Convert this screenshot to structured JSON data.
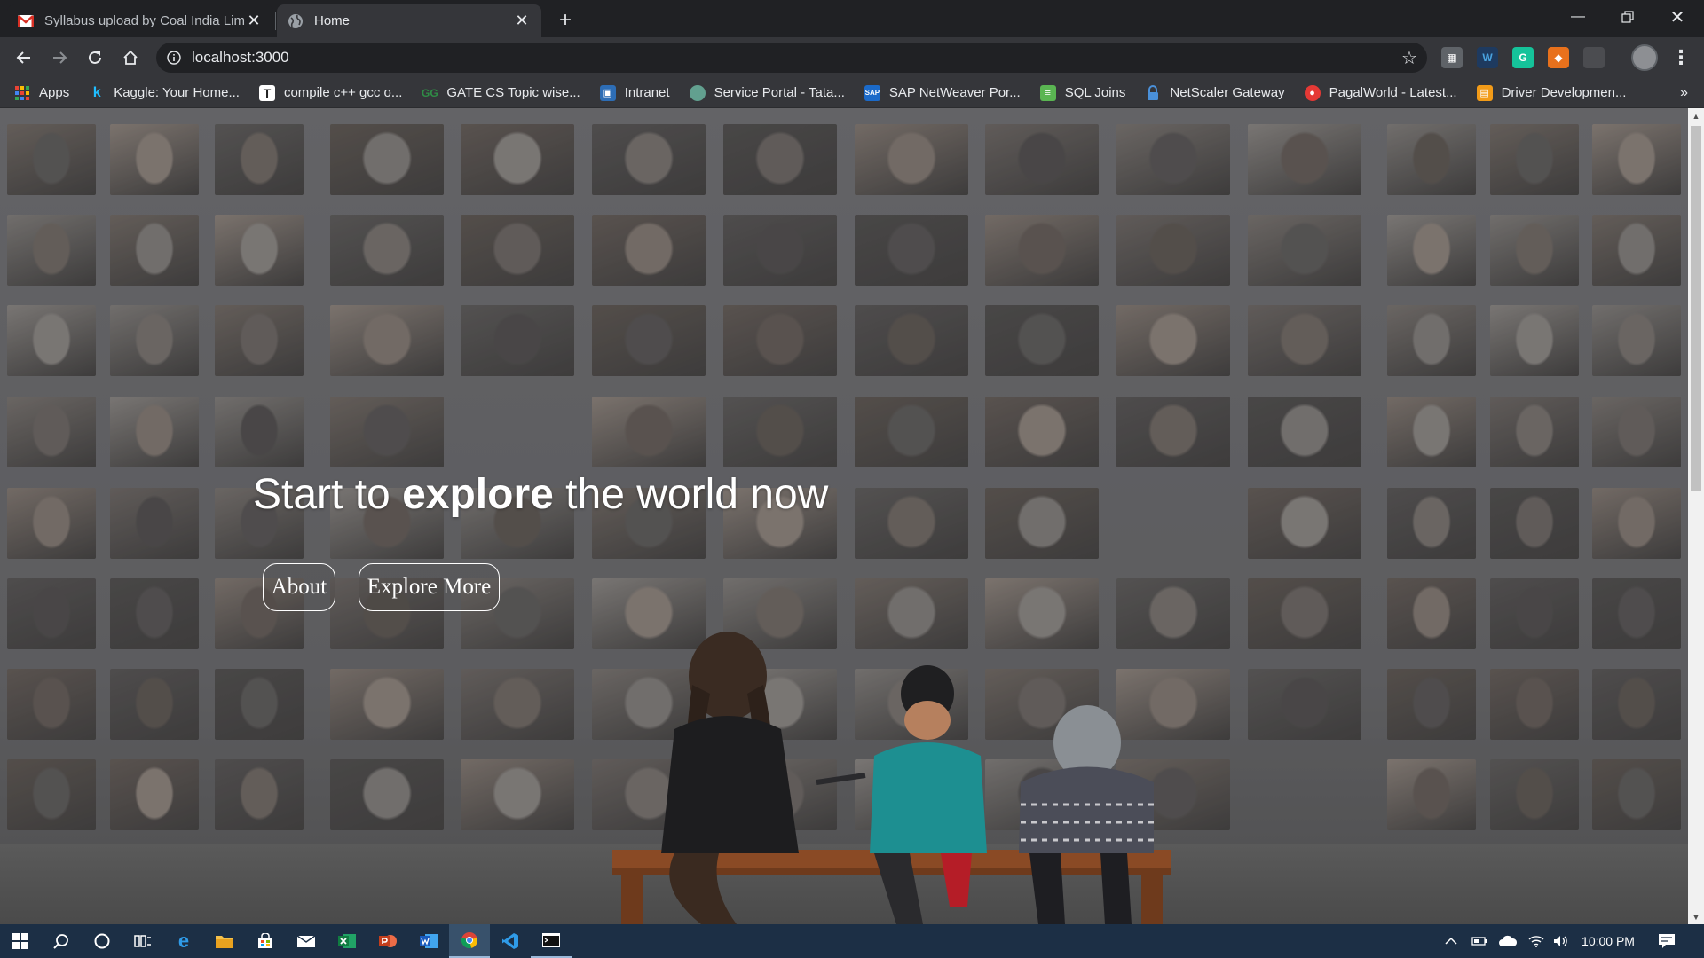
{
  "browser": {
    "tabs": [
      {
        "title": "Syllabus upload by Coal India Lim",
        "favicon": "gmail-icon",
        "active": false
      },
      {
        "title": "Home",
        "favicon": "globe-icon",
        "active": true
      }
    ],
    "url": "localhost:3000",
    "bookmarks": [
      {
        "label": "Apps",
        "icon": "apps-grid-icon",
        "color": "#e8eaed"
      },
      {
        "label": "Kaggle: Your Home...",
        "icon": "kaggle-icon",
        "color": "#20beff"
      },
      {
        "label": "compile c++ gcc o...",
        "icon": "t-icon",
        "color": "#ffffff"
      },
      {
        "label": "GATE CS Topic wise...",
        "icon": "gfg-icon",
        "color": "#2f8d46"
      },
      {
        "label": "Intranet",
        "icon": "tata-icon",
        "color": "#2d6db5"
      },
      {
        "label": "Service Portal - Tata...",
        "icon": "portal-icon",
        "color": "#62a08f"
      },
      {
        "label": "SAP NetWeaver Por...",
        "icon": "sap-icon",
        "color": "#1b6ac9"
      },
      {
        "label": "SQL Joins",
        "icon": "sql-icon",
        "color": "#5ab552"
      },
      {
        "label": "NetScaler Gateway",
        "icon": "lock-icon",
        "color": "#4a90d9"
      },
      {
        "label": "PagalWorld - Latest...",
        "icon": "pagalworld-icon",
        "color": "#e53935"
      },
      {
        "label": "Driver Developmen...",
        "icon": "driver-icon",
        "color": "#f29b18"
      }
    ]
  },
  "page": {
    "hero_plain_1": "Start to ",
    "hero_bold": "explore",
    "hero_plain_2": " the world now",
    "about_label": "About",
    "explore_label": "Explore More"
  },
  "taskbar": {
    "clock": "10:00 PM",
    "accent": "#1c2f45"
  }
}
